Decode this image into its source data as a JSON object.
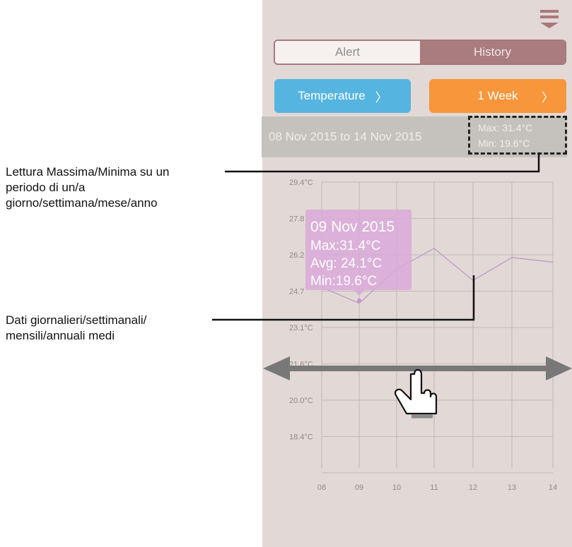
{
  "tabs": {
    "alert": "Alert",
    "history": "History"
  },
  "buttons": {
    "temperature": "Temperature",
    "period": "1 Week",
    "chevron": "〉"
  },
  "range": {
    "text": "08 Nov 2015 to 14 Nov 2015",
    "max": "Max: 31.4°C",
    "min": "Min: 19.6°C"
  },
  "tooltip": {
    "date": "09 Nov 2015",
    "max": "Max:31.4°C",
    "avg": "Avg: 24.1°C",
    "min": "Min:19.6°C"
  },
  "chart_data": {
    "type": "line",
    "y_ticks": [
      "29.4°C",
      "27.8",
      "26.2",
      "24.7",
      "23.1°C",
      "21.6°C",
      "20.0°C",
      "18.4°C"
    ],
    "x_ticks": [
      "08",
      "09",
      "10",
      "11",
      "12",
      "13",
      "14"
    ],
    "x": [
      "08",
      "09",
      "10",
      "11",
      "12",
      "13",
      "14"
    ],
    "values": [
      24.8,
      24.1,
      25.6,
      26.5,
      25.1,
      26.1,
      25.9
    ],
    "ylim": [
      16.9,
      29.4
    ],
    "grid": true
  },
  "annotations": {
    "minmax_line1": "Lettura Massima/Minima su un",
    "minmax_line2": "periodo di un/a",
    "minmax_line3": "giorno/settimana/mese/anno",
    "avg_line1": "Dati giornalieri/settimanali/",
    "avg_line2": "mensili/annuali medi"
  },
  "icons": {
    "menu": "menu-icon",
    "swipe": "hand-pointer-icon",
    "arrows": "double-arrow-icon"
  },
  "colors": {
    "temperature": "#56b5e0",
    "period": "#f7963a",
    "history_active": "#a97c80",
    "tooltip": "#d9a9d9",
    "line": "#b995c8"
  }
}
